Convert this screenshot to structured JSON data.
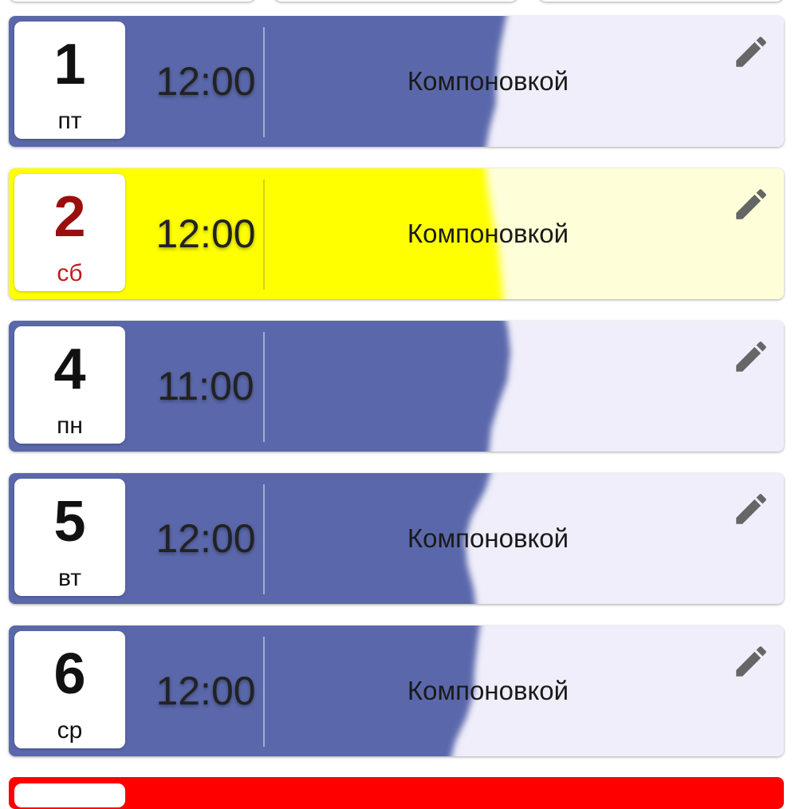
{
  "colors": {
    "blue": "#5a67ab",
    "light": "#efeefa",
    "yellow": "#ffff00",
    "light_yellow": "#fefed8",
    "red": "#ff0000",
    "weekend_text": "#9b0e0e"
  },
  "entries": [
    {
      "day": "1",
      "weekday": "пт",
      "time": "12:00",
      "text": "Компоновкой",
      "edit_icon": "pencil-icon"
    },
    {
      "day": "2",
      "weekday": "сб",
      "time": "12:00",
      "text": "Компоновкой",
      "edit_icon": "pencil-icon"
    },
    {
      "day": "4",
      "weekday": "пн",
      "time": "11:00",
      "text": "",
      "edit_icon": "pencil-icon"
    },
    {
      "day": "5",
      "weekday": "вт",
      "time": "12:00",
      "text": "Компоновкой",
      "edit_icon": "pencil-icon"
    },
    {
      "day": "6",
      "weekday": "ср",
      "time": "12:00",
      "text": "Компоновкой",
      "edit_icon": "pencil-icon"
    }
  ]
}
